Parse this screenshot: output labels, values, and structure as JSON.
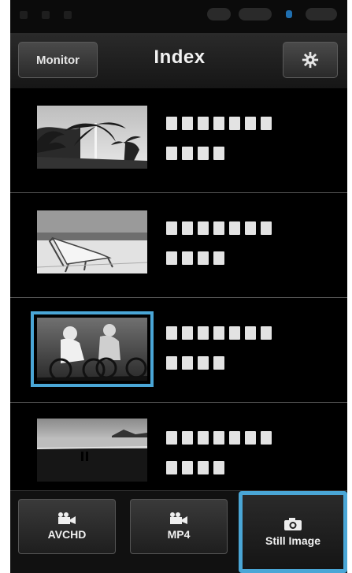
{
  "header": {
    "left_button": "Monitor",
    "title": "Index",
    "right_button_icon": "gear-icon"
  },
  "list": {
    "items": [
      {
        "thumbnail": "palm trees",
        "selected": false
      },
      {
        "thumbnail": "beach chair",
        "selected": false
      },
      {
        "thumbnail": "cyclists",
        "selected": true
      },
      {
        "thumbnail": "sunset beach",
        "selected": false
      }
    ]
  },
  "tabs": [
    {
      "label": "AVCHD",
      "icon": "video-camera-icon",
      "active": false
    },
    {
      "label": "MP4",
      "icon": "video-camera-icon",
      "active": false
    },
    {
      "label": "Still Image",
      "icon": "camera-icon",
      "active": true
    }
  ],
  "colors": {
    "accent": "#4aa6d6",
    "background": "#000000",
    "header_bg": "#222222"
  }
}
